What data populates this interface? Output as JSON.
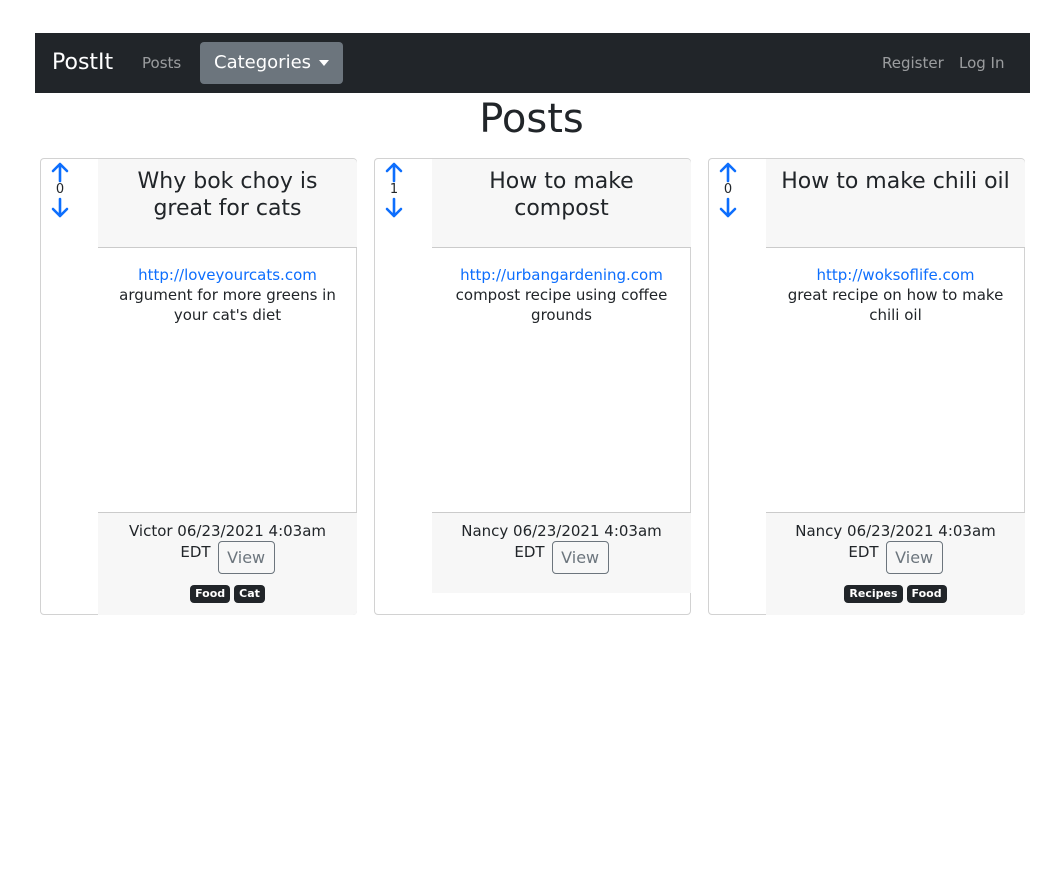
{
  "nav": {
    "brand": "PostIt",
    "posts": "Posts",
    "categories": "Categories",
    "register": "Register",
    "login": "Log In"
  },
  "page": {
    "title": "Posts"
  },
  "posts": [
    {
      "score": "0",
      "title": "Why bok choy is great for cats",
      "url": "http://loveyourcats.com",
      "description": "argument for more greens in your cat's diet",
      "author_date": "Victor 06/23/2021 4:03am",
      "tz": "EDT",
      "view": "View",
      "tags": [
        "Food",
        "Cat"
      ]
    },
    {
      "score": "1",
      "title": "How to make compost",
      "url": "http://urbangardening.com",
      "description": "compost recipe using coffee grounds",
      "author_date": "Nancy 06/23/2021 4:03am",
      "tz": "EDT",
      "view": "View",
      "tags": []
    },
    {
      "score": "0",
      "title": "How to make chili oil",
      "url": "http://woksoflife.com",
      "description": "great recipe on how to make chili oil",
      "author_date": "Nancy 06/23/2021 4:03am",
      "tz": "EDT",
      "view": "View",
      "tags": [
        "Recipes",
        "Food"
      ]
    }
  ],
  "colors": {
    "navbar": "#212529",
    "link": "#0d6efd",
    "category_button": "#6c757d",
    "arrow": "#0d6efd"
  },
  "icons": {
    "upvote": "arrow-up-icon",
    "downvote": "arrow-down-icon",
    "dropdown": "caret-down-icon"
  }
}
